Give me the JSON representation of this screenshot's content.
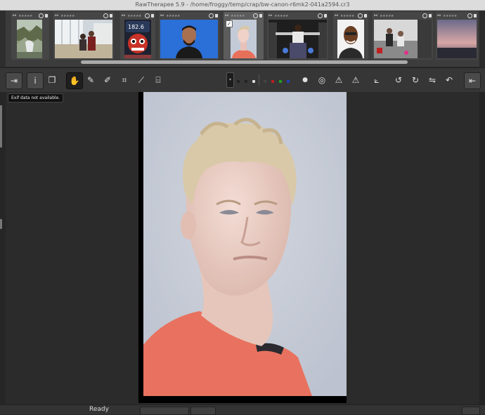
{
  "window": {
    "title": "RawTherapee 5.9 - /home/froggy/temp/crap/bw-canon-r6mk2-041a2594.cr3"
  },
  "filmstrip": {
    "thumbs": [
      {
        "stars": "★★★★★",
        "link": "⚯",
        "selected": false
      },
      {
        "stars": "★★★★★",
        "link": "⚯",
        "selected": false
      },
      {
        "stars": "★★★★★",
        "link": "⚯",
        "selected": false
      },
      {
        "stars": "★★★★★",
        "link": "⚯",
        "selected": false
      },
      {
        "stars": "★★★★★",
        "link": "⚯",
        "selected": true,
        "check": "✓"
      },
      {
        "stars": "★★★★★",
        "link": "⚯",
        "selected": false
      },
      {
        "stars": "★★★★★",
        "link": "⚯",
        "selected": false
      },
      {
        "stars": "★★★★★",
        "link": "⚯",
        "selected": false
      },
      {
        "stars": "★★★★★",
        "link": "⚯",
        "selected": false
      }
    ],
    "sign_text": "182.6"
  },
  "toolbar": {
    "icons": {
      "collapse_left": "⇥",
      "info": "i",
      "before_after": "❐",
      "hand": "✋",
      "color_picker": "✎",
      "white_balance": "✐",
      "crop": "⌗",
      "straighten": "⟋",
      "perspective": "⌸",
      "dropdown": "▾",
      "indicator_a": "●",
      "indicator_b": "◎",
      "warn_shadow": "⚠",
      "warn_highlight": "⚠",
      "histogram": "⟀",
      "rotate_left": "↺",
      "rotate_right": "↻",
      "flip": "⇋",
      "reset": "↶",
      "collapse_right": "⇤"
    },
    "channel_dots": [
      "#222222",
      "#222222",
      "#dddddd",
      "#444444",
      "#c02020",
      "#20a020",
      "#2040c0",
      "#c0c020"
    ]
  },
  "tooltip": {
    "text": "Exif data not available."
  },
  "statusbar": {
    "status": "Ready"
  }
}
